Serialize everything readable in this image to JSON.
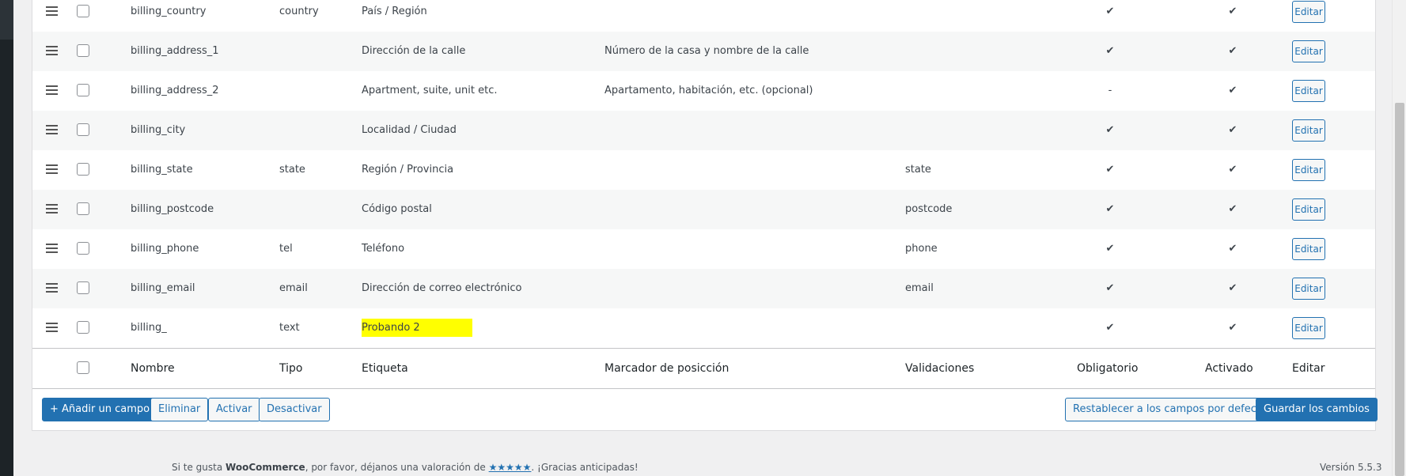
{
  "rows": [
    {
      "name": "billing_country",
      "type": "country",
      "label": "País / Región",
      "placeholder": "",
      "validations": "",
      "required": "✔",
      "enabled": "✔",
      "edit": "Editar"
    },
    {
      "name": "billing_address_1",
      "type": "",
      "label": "Dirección de la calle",
      "placeholder": "Número de la casa y nombre de la calle",
      "validations": "",
      "required": "✔",
      "enabled": "✔",
      "edit": "Editar"
    },
    {
      "name": "billing_address_2",
      "type": "",
      "label": "Apartment, suite, unit etc.",
      "placeholder": "Apartamento, habitación, etc. (opcional)",
      "validations": "",
      "required": "-",
      "enabled": "✔",
      "edit": "Editar"
    },
    {
      "name": "billing_city",
      "type": "",
      "label": "Localidad / Ciudad",
      "placeholder": "",
      "validations": "",
      "required": "✔",
      "enabled": "✔",
      "edit": "Editar"
    },
    {
      "name": "billing_state",
      "type": "state",
      "label": "Región / Provincia",
      "placeholder": "",
      "validations": "state",
      "required": "✔",
      "enabled": "✔",
      "edit": "Editar"
    },
    {
      "name": "billing_postcode",
      "type": "",
      "label": "Código postal",
      "placeholder": "",
      "validations": "postcode",
      "required": "✔",
      "enabled": "✔",
      "edit": "Editar"
    },
    {
      "name": "billing_phone",
      "type": "tel",
      "label": "Teléfono",
      "placeholder": "",
      "validations": "phone",
      "required": "✔",
      "enabled": "✔",
      "edit": "Editar"
    },
    {
      "name": "billing_email",
      "type": "email",
      "label": "Dirección de correo electrónico",
      "placeholder": "",
      "validations": "email",
      "required": "✔",
      "enabled": "✔",
      "edit": "Editar"
    },
    {
      "name": "billing_",
      "type": "text",
      "label": "Probando 2",
      "placeholder": "",
      "validations": "",
      "required": "✔",
      "enabled": "✔",
      "edit": "Editar"
    }
  ],
  "columns": {
    "name": "Nombre",
    "type": "Tipo",
    "label": "Etiqueta",
    "placeholder": "Marcador de posicción",
    "validations": "Validaciones",
    "required": "Obligatorio",
    "enabled": "Activado",
    "edit": "Editar"
  },
  "actions": {
    "add": "+ Añadir un campo",
    "delete": "Eliminar",
    "activate": "Activar",
    "deactivate": "Desactivar",
    "reset": "Restablecer a los campos por defecto",
    "save": "Guardar los cambios"
  },
  "footer": {
    "text_before": "Si te gusta ",
    "brand": "WooCommerce",
    "text_mid": ", por favor, déjanos una valoración de ",
    "stars": "★★★★★",
    "text_after": ". ¡Gracias anticipadas!",
    "version": "Versión 5.5.3"
  },
  "colors": {
    "accent": "#2271b1",
    "highlight": "#ffff00"
  }
}
